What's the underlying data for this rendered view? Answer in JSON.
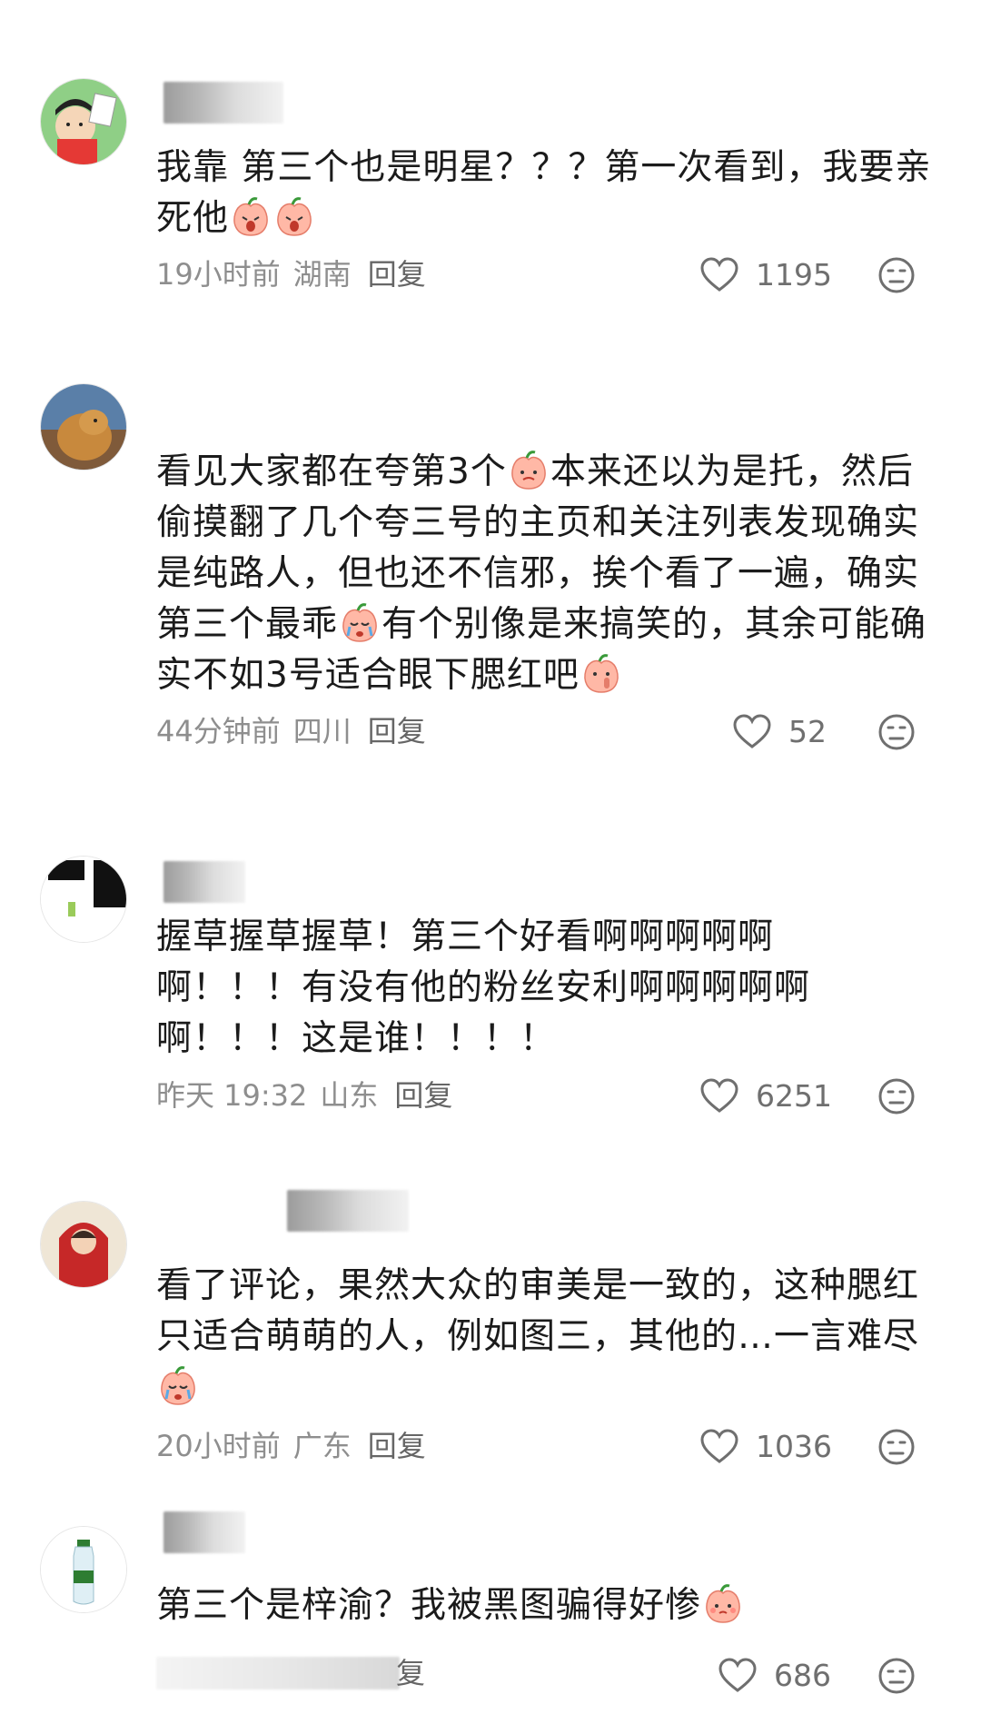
{
  "comments": [
    {
      "text": "我靠 第三个也是明星？？？第一次看到，我要亲死他",
      "time": "19小时前",
      "location": "湖南",
      "reply": "回复",
      "likes": "1195"
    },
    {
      "text_parts": [
        "看见大家都在夸第3个",
        "本来还以为是托，然后偷摸翻了几个夸三号的主页和关注列表发现确实是纯路人，但也还不信邪，挨个看了一遍，确实第三个最乖",
        "有个别像是来搞笑的，其余可能确实不如3号适合眼下腮红吧"
      ],
      "time": "44分钟前",
      "location": "四川",
      "reply": "回复",
      "likes": "52"
    },
    {
      "text": "握草握草握草！第三个好看啊啊啊啊啊啊！！！有没有他的粉丝安利啊啊啊啊啊啊！！！这是谁！！！！",
      "time": "昨天 19:32",
      "location": "山东",
      "reply": "回复",
      "likes": "6251"
    },
    {
      "text": "看了评论，果然大众的审美是一致的，这种腮红只适合萌萌的人，例如图三，其他的…一言难尽",
      "time": "20小时前",
      "location": "广东",
      "reply": "回复",
      "likes": "1036"
    },
    {
      "text": "第三个是梓渝？我被黑图骗得好惨",
      "reply": "复",
      "likes": "686"
    }
  ],
  "icons": {
    "like": "heart-outline-icon",
    "dislike": "meh-face-icon",
    "emoji": "peach-face-emoji"
  },
  "colors": {
    "meta": "#8e8e8e",
    "text": "#1b1b1b"
  }
}
